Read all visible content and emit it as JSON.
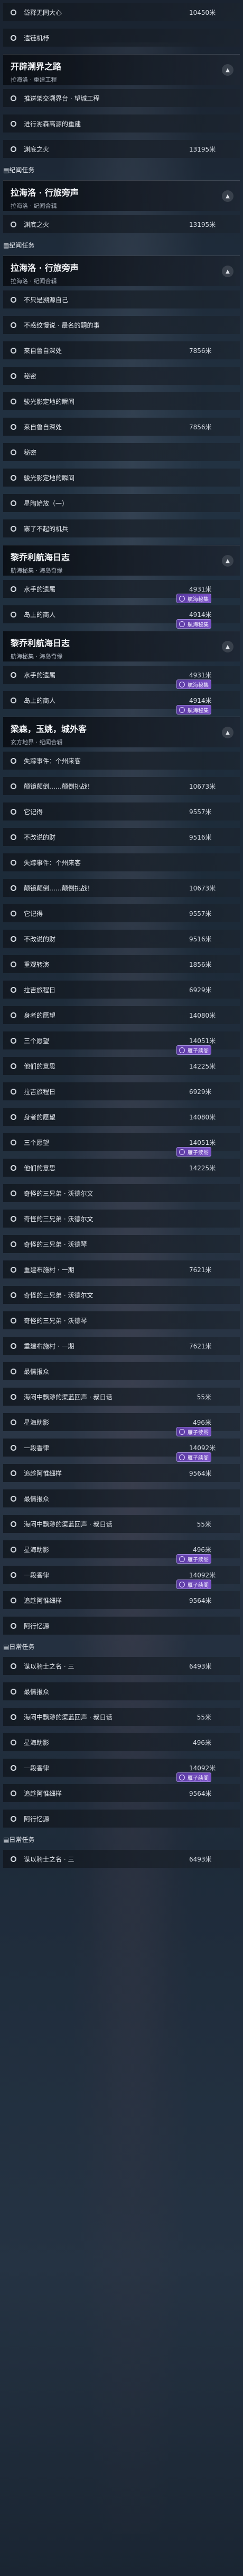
{
  "rows": [
    {
      "kind": "task",
      "label": "岱释无同大心",
      "value": "10450米"
    },
    {
      "kind": "task",
      "label": "遗链机杼",
      "value": ""
    },
    {
      "kind": "chapter",
      "title": "开辟溯界之路",
      "subtitle": "拉海洛 · 重建工程"
    },
    {
      "kind": "task",
      "label": "推送架交溯界台 · 望城工程",
      "value": ""
    },
    {
      "kind": "task",
      "label": "进行溯森高源的重建",
      "value": ""
    },
    {
      "kind": "task",
      "label": "渊底之火",
      "value": "13195米"
    },
    {
      "kind": "section",
      "color": "blue",
      "label": "纪闻任务"
    },
    {
      "kind": "chapter",
      "title": "拉海洛 · 行旅旁声",
      "subtitle": "拉海洛 · 纪闻合辑"
    },
    {
      "kind": "task",
      "label": "渊底之火",
      "value": "13195米"
    },
    {
      "kind": "section",
      "color": "blue",
      "label": "纪闻任务"
    },
    {
      "kind": "chapter",
      "title": "拉海洛 · 行旅旁声",
      "subtitle": "拉海洛 · 纪闻合辑"
    },
    {
      "kind": "task",
      "label": "不只是溯源自己",
      "value": ""
    },
    {
      "kind": "task",
      "label": "不惑纹慢说 · 最名的嗣的事",
      "value": ""
    },
    {
      "kind": "task",
      "label": "来自鲁自深处",
      "value": "7856米"
    },
    {
      "kind": "task",
      "label": "秘密",
      "value": ""
    },
    {
      "kind": "task",
      "label": "骏光影定地的瞬间",
      "value": ""
    },
    {
      "kind": "task",
      "label": "来自鲁自深处",
      "value": "7856米"
    },
    {
      "kind": "task",
      "label": "秘密",
      "value": ""
    },
    {
      "kind": "task",
      "label": "骏光影定地的瞬间",
      "value": ""
    },
    {
      "kind": "task",
      "label": "星陶始放（一）",
      "value": ""
    },
    {
      "kind": "task",
      "label": "寨了不起的机兵",
      "value": ""
    },
    {
      "kind": "chapter",
      "title": "黎乔利航海日志",
      "subtitle": "航海秘集 · 海岛奇缘"
    },
    {
      "kind": "task",
      "label": "水手的遗属",
      "value": "4931米",
      "badge": "航海秘集"
    },
    {
      "kind": "task",
      "label": "岛上的商人",
      "value": "4914米",
      "badge": "航海秘集"
    },
    {
      "kind": "chapter",
      "title": "黎乔利航海日志",
      "subtitle": "航海秘集 · 海岛奇缘"
    },
    {
      "kind": "task",
      "label": "水手的遗属",
      "value": "4931米",
      "badge": "航海秘集"
    },
    {
      "kind": "task",
      "label": "岛上的商人",
      "value": "4914米",
      "badge": "航海秘集"
    },
    {
      "kind": "chapter",
      "title": "梁森，玉姚，城外客",
      "subtitle": "玄方地界 · 纪闻合辑"
    },
    {
      "kind": "task",
      "label": "失踪事件：个州来客",
      "value": ""
    },
    {
      "kind": "task",
      "label": "颠镜颠倒……颠倒挑战！",
      "value": "10673米"
    },
    {
      "kind": "task",
      "label": "它记得",
      "value": "9557米"
    },
    {
      "kind": "task",
      "label": "不改说的财",
      "value": "9516米"
    },
    {
      "kind": "task",
      "label": "失踪事件：个州来客",
      "value": ""
    },
    {
      "kind": "task",
      "label": "颠镜颠倒……颠倒挑战！",
      "value": "10673米"
    },
    {
      "kind": "task",
      "label": "它记得",
      "value": "9557米"
    },
    {
      "kind": "task",
      "label": "不改说的财",
      "value": "9516米"
    },
    {
      "kind": "task",
      "label": "重观转演",
      "value": "1856米"
    },
    {
      "kind": "task",
      "label": "拉吉旅程日",
      "value": "6929米"
    },
    {
      "kind": "task",
      "label": "身者的愿望",
      "value": "14080米"
    },
    {
      "kind": "task",
      "label": "三个愿望",
      "value": "14051米",
      "badge": "雁子续阁"
    },
    {
      "kind": "task",
      "label": "他们的意思",
      "value": "14225米"
    },
    {
      "kind": "task",
      "label": "拉吉旅程日",
      "value": "6929米"
    },
    {
      "kind": "task",
      "label": "身者的愿望",
      "value": "14080米"
    },
    {
      "kind": "task",
      "label": "三个愿望",
      "value": "14051米",
      "badge": "雁子续阁"
    },
    {
      "kind": "task",
      "label": "他们的意思",
      "value": "14225米"
    },
    {
      "kind": "task",
      "label": "奇怪的三兄弟 · 沃德尔文",
      "value": ""
    },
    {
      "kind": "task",
      "label": "奇怪的三兄弟 · 沃德尔文",
      "value": ""
    },
    {
      "kind": "task",
      "label": "奇怪的三兄弟 · 沃德琴",
      "value": ""
    },
    {
      "kind": "task",
      "label": "重建布施村 · 一期",
      "value": "7621米"
    },
    {
      "kind": "task",
      "label": "奇怪的三兄弟 · 沃德尔文",
      "value": ""
    },
    {
      "kind": "task",
      "label": "奇怪的三兄弟 · 沃德琴",
      "value": ""
    },
    {
      "kind": "task",
      "label": "重建布施村 · 一期",
      "value": "7621米"
    },
    {
      "kind": "task",
      "label": "最情报众",
      "value": ""
    },
    {
      "kind": "task",
      "label": "海闷中飘渺的渠蓝回声 · 叔日话",
      "value": "55米"
    },
    {
      "kind": "task",
      "label": "星海助影",
      "value": "496米",
      "badge": "雁子续阁"
    },
    {
      "kind": "task",
      "label": "一段香律",
      "value": "14092米",
      "badge": "雁子续阁"
    },
    {
      "kind": "task",
      "label": "追趁阿惟细样",
      "value": "9564米"
    },
    {
      "kind": "task",
      "label": "最情报众",
      "value": ""
    },
    {
      "kind": "task",
      "label": "海闷中飘渺的渠蓝回声 · 叔日话",
      "value": "55米"
    },
    {
      "kind": "task",
      "label": "星海助影",
      "value": "496米",
      "badge": "雁子续阁"
    },
    {
      "kind": "task",
      "label": "一段香律",
      "value": "14092米",
      "badge": "雁子续阁"
    },
    {
      "kind": "task",
      "label": "追趁阿惟细样",
      "value": "9564米"
    },
    {
      "kind": "task",
      "label": "阿行忆源",
      "value": ""
    },
    {
      "kind": "section",
      "color": "gold",
      "label": "日常任务"
    },
    {
      "kind": "task",
      "label": "谋以骑士之名 · 三",
      "value": "6493米"
    },
    {
      "kind": "task",
      "label": "最情报众",
      "value": ""
    },
    {
      "kind": "task",
      "label": "海闷中飘渺的渠蓝回声 · 叔日话",
      "value": "55米"
    },
    {
      "kind": "task",
      "label": "星海助影",
      "value": "496米"
    },
    {
      "kind": "task",
      "label": "一段香律",
      "value": "14092米",
      "badge": "雁子续阁"
    },
    {
      "kind": "task",
      "label": "追趁阿惟细样",
      "value": "9564米"
    },
    {
      "kind": "task",
      "label": "阿行忆源",
      "value": ""
    },
    {
      "kind": "section",
      "color": "gold",
      "label": "日常任务"
    },
    {
      "kind": "task",
      "label": "谋以骑士之名 · 三",
      "value": "6493米"
    }
  ]
}
